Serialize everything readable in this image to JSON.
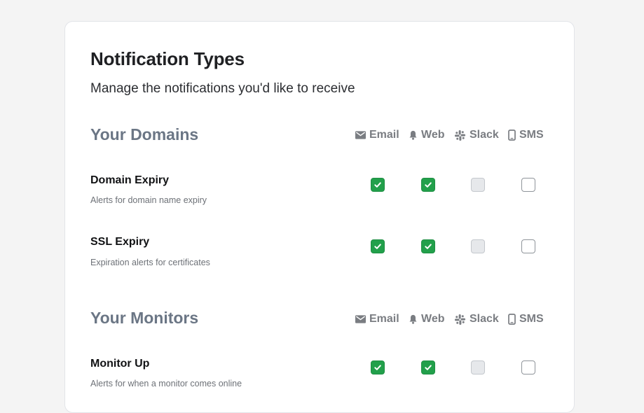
{
  "page": {
    "title": "Notification Types",
    "subtitle": "Manage the notifications you'd like to receive"
  },
  "channels": {
    "email": "Email",
    "web": "Web",
    "slack": "Slack",
    "sms": "SMS",
    "icons": [
      "mail-icon",
      "bell-icon",
      "slack-icon",
      "phone-icon"
    ]
  },
  "sections": [
    {
      "title": "Your Domains",
      "rows": [
        {
          "title": "Domain Expiry",
          "description": "Alerts for domain name expiry",
          "email": "checked",
          "web": "checked",
          "slack": "disabled",
          "sms": "unchecked"
        },
        {
          "title": "SSL Expiry",
          "description": "Expiration alerts for certificates",
          "email": "checked",
          "web": "checked",
          "slack": "disabled",
          "sms": "unchecked"
        }
      ]
    },
    {
      "title": "Your Monitors",
      "rows": [
        {
          "title": "Monitor Up",
          "description": "Alerts for when a monitor comes online",
          "email": "checked",
          "web": "checked",
          "slack": "disabled",
          "sms": "unchecked"
        }
      ]
    }
  ],
  "colors": {
    "checked": "#22a04b",
    "section_title": "#6b7685",
    "page_background": "#f4f4f4"
  }
}
